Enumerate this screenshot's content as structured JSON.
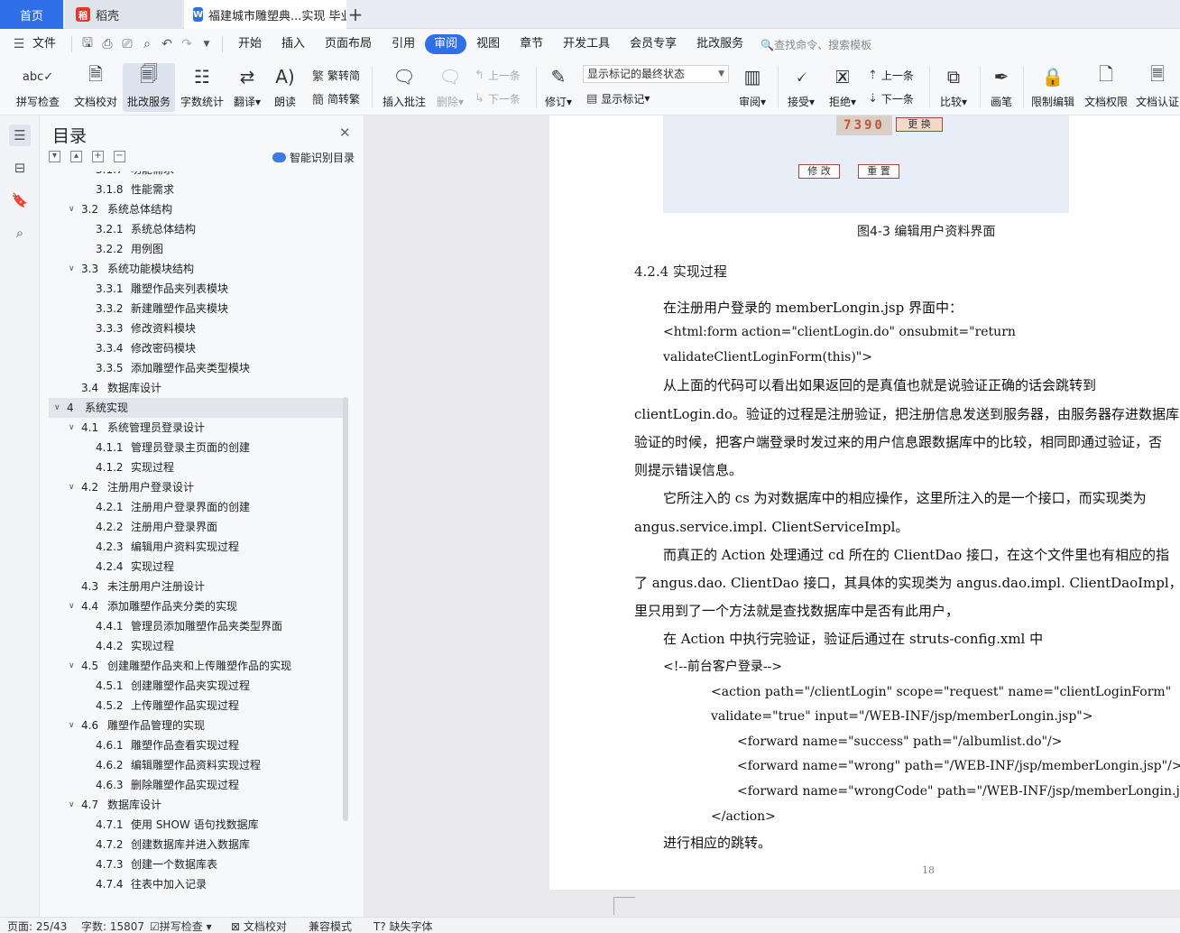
{
  "tabs": {
    "home": "首页",
    "daoke": "稻壳",
    "doc": "福建城市雕塑典...实现 毕业"
  },
  "menu": {
    "file": "文件",
    "items": [
      "开始",
      "插入",
      "页面布局",
      "引用",
      "审阅",
      "视图",
      "章节",
      "开发工具",
      "会员专享",
      "批改服务"
    ],
    "active": "审阅",
    "search": "查找命令、搜索模板"
  },
  "ribbon": {
    "spell_check": "拼写检查",
    "doc_proof": "文档校对",
    "review_service": "批改服务",
    "word_count": "字数统计",
    "translate": "翻译",
    "read_aloud": "朗读",
    "trad_simp": "繁转简",
    "simp_trad": "简转繁",
    "insert_comment": "插入批注",
    "delete": "删除",
    "prev_comment": "上一条",
    "next_comment": "下一条",
    "revise": "修订",
    "markup_state": "显示标记的最终状态",
    "show_markup": "显示标记",
    "review_pane": "审阅",
    "accept": "接受",
    "reject": "拒绝",
    "prev_change": "上一条",
    "next_change": "下一条",
    "compare": "比较",
    "pen": "画笔",
    "restrict_edit": "限制编辑",
    "doc_perm": "文档权限",
    "doc_cert": "文档认证"
  },
  "toc": {
    "title": "目录",
    "smart": "智能识别目录",
    "items": [
      {
        "num": "3.1.7",
        "text": "功能需求",
        "level": 3
      },
      {
        "num": "3.1.8",
        "text": "性能需求",
        "level": 3
      },
      {
        "num": "3.2",
        "text": "系统总体结构",
        "level": 2
      },
      {
        "num": "3.2.1",
        "text": "系统总体结构",
        "level": 3
      },
      {
        "num": "3.2.2",
        "text": "用例图",
        "level": 3
      },
      {
        "num": "3.3",
        "text": "系统功能模块结构",
        "level": 2
      },
      {
        "num": "3.3.1",
        "text": "雕塑作品夹列表模块",
        "level": 3
      },
      {
        "num": "3.3.2",
        "text": "新建雕塑作品夹模块",
        "level": 3
      },
      {
        "num": "3.3.3",
        "text": "修改资料模块",
        "level": 3
      },
      {
        "num": "3.3.4",
        "text": "修改密码模块",
        "level": 3
      },
      {
        "num": "3.3.5",
        "text": "添加雕塑作品夹类型模块",
        "level": 3
      },
      {
        "num": "3.4",
        "text": "数据库设计",
        "level": 2
      },
      {
        "num": "4",
        "text": "系统实现",
        "level": 1
      },
      {
        "num": "4.1",
        "text": "系统管理员登录设计",
        "level": 2
      },
      {
        "num": "4.1.1",
        "text": "管理员登录主页面的创建",
        "level": 3
      },
      {
        "num": "4.1.2",
        "text": "实现过程",
        "level": 3
      },
      {
        "num": "4.2",
        "text": "注册用户登录设计",
        "level": 2
      },
      {
        "num": "4.2.1",
        "text": "注册用户登录界面的创建",
        "level": 3
      },
      {
        "num": "4.2.2",
        "text": "注册用户登录界面",
        "level": 3
      },
      {
        "num": "4.2.3",
        "text": "编辑用户资料实现过程",
        "level": 3
      },
      {
        "num": "4.2.4",
        "text": "实现过程",
        "level": 3
      },
      {
        "num": "4.3",
        "text": "未注册用户注册设计",
        "level": 2
      },
      {
        "num": "4.4",
        "text": "添加雕塑作品夹分类的实现",
        "level": 2
      },
      {
        "num": "4.4.1",
        "text": "管理员添加雕塑作品夹类型界面",
        "level": 3
      },
      {
        "num": "4.4.2",
        "text": "实现过程",
        "level": 3
      },
      {
        "num": "4.5",
        "text": "创建雕塑作品夹和上传雕塑作品的实现",
        "level": 2
      },
      {
        "num": "4.5.1",
        "text": "创建雕塑作品夹实现过程",
        "level": 3
      },
      {
        "num": "4.5.2",
        "text": "上传雕塑作品实现过程",
        "level": 3
      },
      {
        "num": "4.6",
        "text": "雕塑作品管理的实现",
        "level": 2
      },
      {
        "num": "4.6.1",
        "text": "雕塑作品查看实现过程",
        "level": 3
      },
      {
        "num": "4.6.2",
        "text": "编辑雕塑作品资料实现过程",
        "level": 3
      },
      {
        "num": "4.6.3",
        "text": "删除雕塑作品实现过程",
        "level": 3
      },
      {
        "num": "4.7",
        "text": "数据库设计",
        "level": 2
      },
      {
        "num": "4.7.1",
        "text": "使用 SHOW 语句找数据库",
        "level": 3
      },
      {
        "num": "4.7.2",
        "text": "创建数据库并进入数据库",
        "level": 3
      },
      {
        "num": "4.7.3",
        "text": "创建一个数据库表",
        "level": 3
      },
      {
        "num": "4.7.4",
        "text": "往表中加入记录",
        "level": 3
      }
    ],
    "selected": "4"
  },
  "document": {
    "captcha": "7390",
    "btn_change": "更 换",
    "btn_modify": "修 改",
    "btn_reset": "重 置",
    "caption": "图4-3  编辑用户资料界面",
    "heading": "4.2.4    实现过程",
    "lines": [
      "在注册用户登录的 memberLongin.jsp 界面中：",
      "<html:form action=\"clientLogin.do\" onsubmit=\"return",
      "validateClientLoginForm(this)\">",
      "从上面的代码可以看出如果返回的是真值也就是说验证正确的话会跳转到",
      "clientLogin.do。验证的过程是注册验证，把注册信息发送到服务器，由服务器存进数据库",
      "验证的时候，把客户端登录时发过来的用户信息跟数据库中的比较，相同即通过验证，否",
      "则提示错误信息。",
      "它所注入的 cs 为对数据库中的相应操作，这里所注入的是一个接口，而实现类为",
      "angus.service.impl. ClientServiceImpl。",
      "而真正的 Action 处理通过 cd 所在的 ClientDao 接口，在这个文件里也有相应的指",
      "了 angus.dao. ClientDao 接口，其具体的实现类为 angus.dao.impl. ClientDaoImpl，在这个文",
      "里只用到了一个方法就是查找数据库中是否有此用户，",
      "在 Action 中执行完验证，验证后通过在 struts-config.xml 中",
      "<!--前台客户登录-->",
      "<action path=\"/clientLogin\" scope=\"request\" name=\"clientLoginForm\"",
      "validate=\"true\" input=\"/WEB-INF/jsp/memberLongin.jsp\">",
      "<forward name=\"success\" path=\"/albumlist.do\"/>",
      "<forward name=\"wrong\" path=\"/WEB-INF/jsp/memberLongin.jsp\"/>",
      "<forward name=\"wrongCode\" path=\"/WEB-INF/jsp/memberLongin.jsp\"/>",
      "</action>",
      "进行相应的跳转。"
    ],
    "page_number": "18"
  },
  "status": {
    "page": "页面: 25/43",
    "words": "字数: 15807",
    "spell": "拼写检查",
    "proof": "文档校对",
    "compat": "兼容模式",
    "missing_font": "缺失字体"
  }
}
